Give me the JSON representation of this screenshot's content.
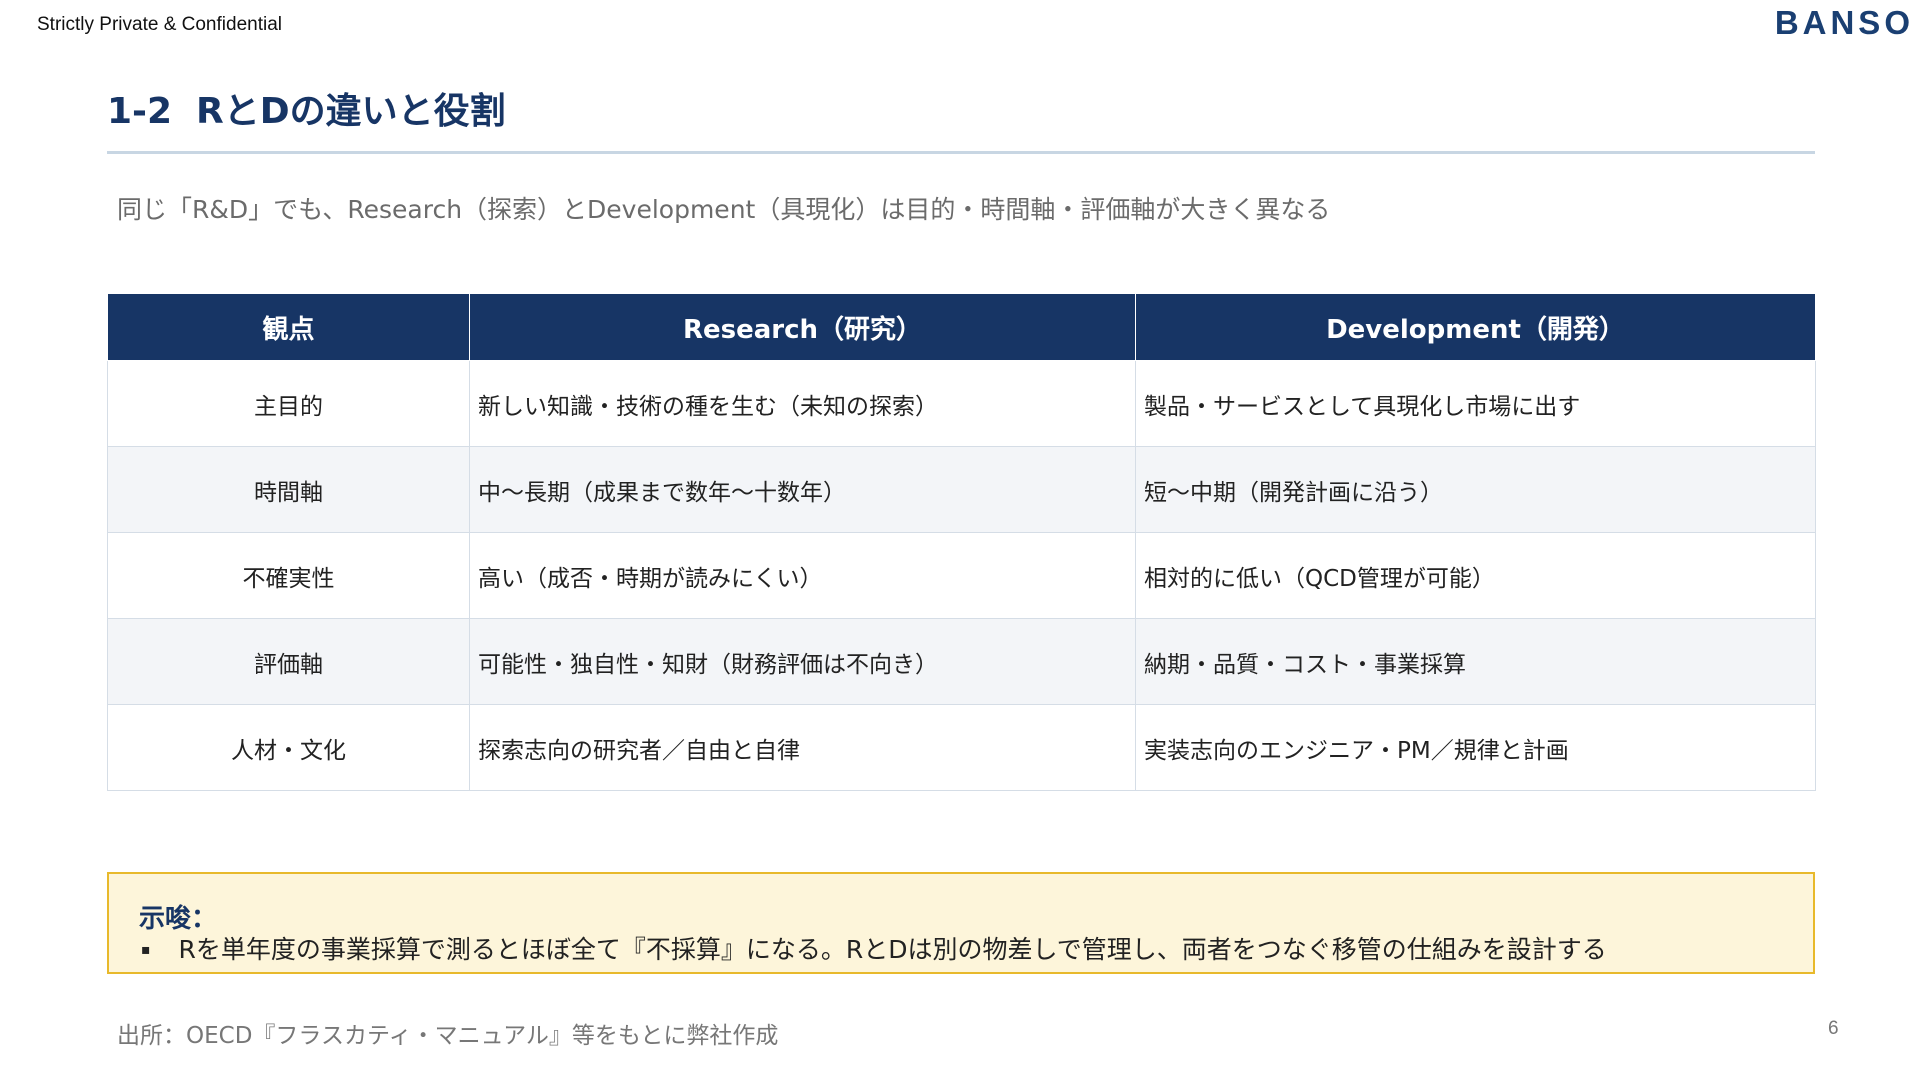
{
  "header": {
    "confidential": "Strictly Private & Confidential",
    "logo": "BANSO"
  },
  "title": {
    "number": "1-2",
    "text": "RとDの違いと役割"
  },
  "subtitle": "同じ「R&D」でも、Research（探索）とDevelopment（具現化）は目的・時間軸・評価軸が大きく異なる",
  "table": {
    "headers": [
      "観点",
      "Research（研究）",
      "Development（開発）"
    ],
    "rows": [
      {
        "aspect": "主目的",
        "research": "新しい知識・技術の種を生む（未知の探索）",
        "development": "製品・サービスとして具現化し市場に出す"
      },
      {
        "aspect": "時間軸",
        "research": "中〜長期（成果まで数年〜十数年）",
        "development": "短〜中期（開発計画に沿う）"
      },
      {
        "aspect": "不確実性",
        "research": "高い（成否・時期が読みにくい）",
        "development": "相対的に低い（QCD管理が可能）"
      },
      {
        "aspect": "評価軸",
        "research": "可能性・独自性・知財（財務評価は不向き）",
        "development": "納期・品質・コスト・事業採算"
      },
      {
        "aspect": "人材・文化",
        "research": "探索志向の研究者／自由と自律",
        "development": "実装志向のエンジニア・PM／規律と計画"
      }
    ]
  },
  "implication": {
    "title": "示唆：",
    "bullet": "▪",
    "text": "Rを単年度の事業採算で測るとほぼ全て『不採算』になる。RとDは別の物差しで管理し、両者をつなぐ移管の仕組みを設計する"
  },
  "footer": {
    "source": "出所：OECD『フラスカティ・マニュアル』等をもとに弊社作成",
    "page": "6"
  },
  "colors": {
    "navy": "#173565",
    "rule": "#c8d6e3",
    "highlight_border": "#e8b92b",
    "highlight_bg": "#fdf5da"
  }
}
